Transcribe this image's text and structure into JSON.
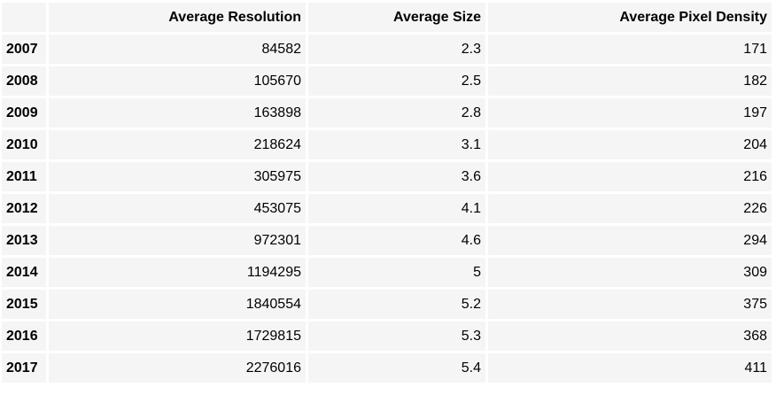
{
  "table": {
    "columns": [
      "",
      "Average Resolution",
      "Average Size",
      "Average Pixel Density"
    ],
    "rows": [
      {
        "year": "2007",
        "resolution": "84582",
        "size": "2.3",
        "density": "171"
      },
      {
        "year": "2008",
        "resolution": "105670",
        "size": "2.5",
        "density": "182"
      },
      {
        "year": "2009",
        "resolution": "163898",
        "size": "2.8",
        "density": "197"
      },
      {
        "year": "2010",
        "resolution": "218624",
        "size": "3.1",
        "density": "204"
      },
      {
        "year": "2011",
        "resolution": "305975",
        "size": "3.6",
        "density": "216"
      },
      {
        "year": "2012",
        "resolution": "453075",
        "size": "4.1",
        "density": "226"
      },
      {
        "year": "2013",
        "resolution": "972301",
        "size": "4.6",
        "density": "294"
      },
      {
        "year": "2014",
        "resolution": "1194295",
        "size": "5",
        "density": "309"
      },
      {
        "year": "2015",
        "resolution": "1840554",
        "size": "5.2",
        "density": "375"
      },
      {
        "year": "2016",
        "resolution": "1729815",
        "size": "5.3",
        "density": "368"
      },
      {
        "year": "2017",
        "resolution": "2276016",
        "size": "5.4",
        "density": "411"
      }
    ]
  }
}
